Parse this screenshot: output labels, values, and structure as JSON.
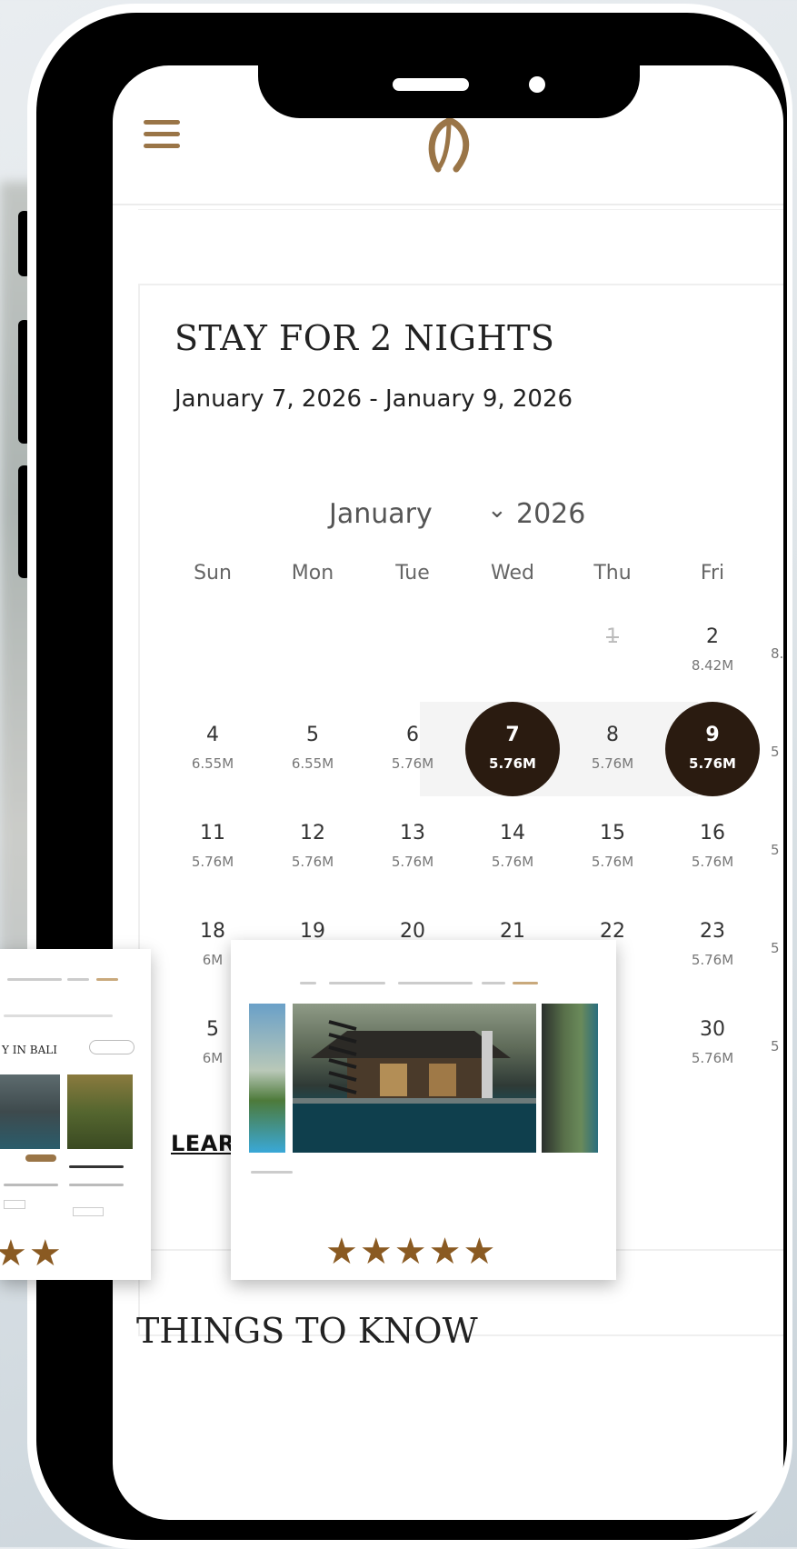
{
  "booking": {
    "title": "STAY FOR 2 NIGHTS",
    "date_range": "January 7, 2026 - January 9, 2026",
    "month": "January",
    "year": "2026",
    "clear_dates_label": "LEAR D",
    "section_title": "THINGS TO KNOW"
  },
  "calendar": {
    "days_of_week": [
      "Sun",
      "Mon",
      "Tue",
      "Wed",
      "Thu",
      "Fri"
    ],
    "rows": [
      [
        {
          "d": "",
          "p": ""
        },
        {
          "d": "",
          "p": ""
        },
        {
          "d": "",
          "p": ""
        },
        {
          "d": "",
          "p": ""
        },
        {
          "d": "1",
          "p": "",
          "strike": true
        },
        {
          "d": "2",
          "p": "8.42M"
        }
      ],
      [
        {
          "d": "4",
          "p": "6.55M"
        },
        {
          "d": "5",
          "p": "6.55M"
        },
        {
          "d": "6",
          "p": "5.76M"
        },
        {
          "d": "7",
          "p": "5.76M",
          "selected": true
        },
        {
          "d": "8",
          "p": "5.76M"
        },
        {
          "d": "9",
          "p": "5.76M",
          "selected": true
        }
      ],
      [
        {
          "d": "11",
          "p": "5.76M"
        },
        {
          "d": "12",
          "p": "5.76M"
        },
        {
          "d": "13",
          "p": "5.76M"
        },
        {
          "d": "14",
          "p": "5.76M"
        },
        {
          "d": "15",
          "p": "5.76M"
        },
        {
          "d": "16",
          "p": "5.76M"
        }
      ],
      [
        {
          "d": "18",
          "p": "6M"
        },
        {
          "d": "19",
          "p": ""
        },
        {
          "d": "20",
          "p": ""
        },
        {
          "d": "21",
          "p": ""
        },
        {
          "d": "22",
          "p": ""
        },
        {
          "d": "23",
          "p": "5.76M"
        }
      ],
      [
        {
          "d": "5",
          "p": "6M"
        },
        {
          "d": "",
          "p": ""
        },
        {
          "d": "",
          "p": ""
        },
        {
          "d": "",
          "p": ""
        },
        {
          "d": "",
          "p": ""
        },
        {
          "d": "30",
          "p": "5.76M"
        }
      ]
    ],
    "right_edge": [
      "8.",
      "5",
      "5",
      "5",
      "5"
    ]
  },
  "float_left": {
    "heading": "Y IN BALI",
    "stars": "★★"
  },
  "float_right": {
    "stars": "★★★★★"
  },
  "colors": {
    "accent": "#9a7547",
    "selected": "#2a1b10",
    "star": "#8a5a22"
  },
  "icons": {
    "menu": "hamburger-icon",
    "logo": "brand-logo-icon",
    "chevron": "chevron-down-icon"
  }
}
